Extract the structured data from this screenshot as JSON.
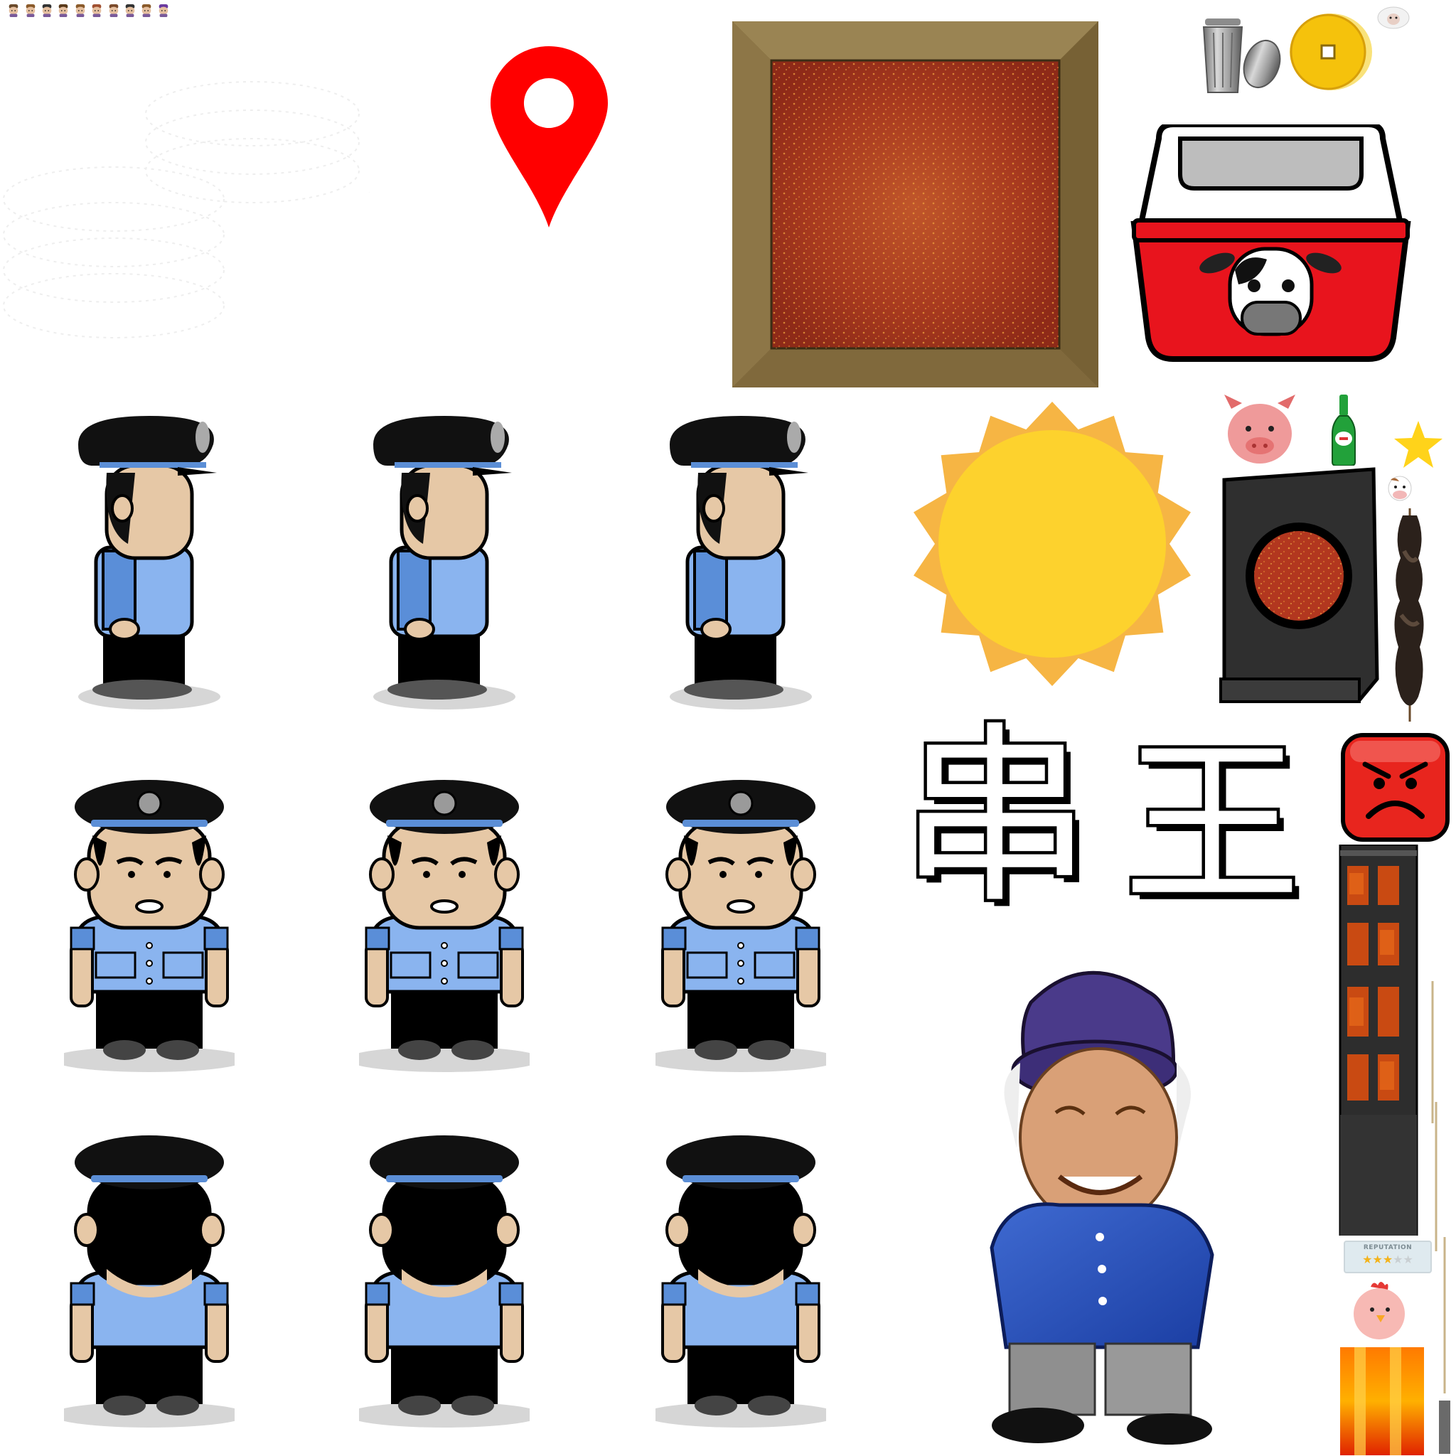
{
  "sheet": {
    "title_chars": [
      "串",
      "王"
    ],
    "reputation": {
      "label": "REPUTATION",
      "stars_filled": 3,
      "stars_total": 5
    }
  },
  "colors": {
    "uniform_blue": "#8ab4ef",
    "uniform_dark": "#5a8ed8",
    "cap_black": "#111111",
    "cap_band": "#5b8ed6",
    "skin": "#e6c8a6",
    "map_pin": "#ff0000",
    "cooler_red": "#e8141d",
    "sun_yellow": "#fdd22d",
    "sun_orange": "#f6b544",
    "angry_face": "#e8251e",
    "coin_gold": "#f5c20c",
    "board_wood": "#8c7546",
    "chili_red": "#b2371f",
    "bottle_green": "#22a13a",
    "star_yellow": "#ffd31a"
  },
  "icons": [
    "tiny-character-icon",
    "map-pin-icon",
    "wooden-chili-board",
    "trash-can-icon",
    "gold-coin-icon",
    "sheep-icon",
    "cooler-box-icon",
    "cow-face-icon",
    "sun-icon",
    "pig-icon",
    "beer-bottle-icon",
    "star-icon",
    "chili-bowl-box",
    "burnt-skewer",
    "angry-face-icon",
    "grill-stand",
    "chicken-icon",
    "fire-strip",
    "old-woman-character",
    "police-officer-character"
  ]
}
